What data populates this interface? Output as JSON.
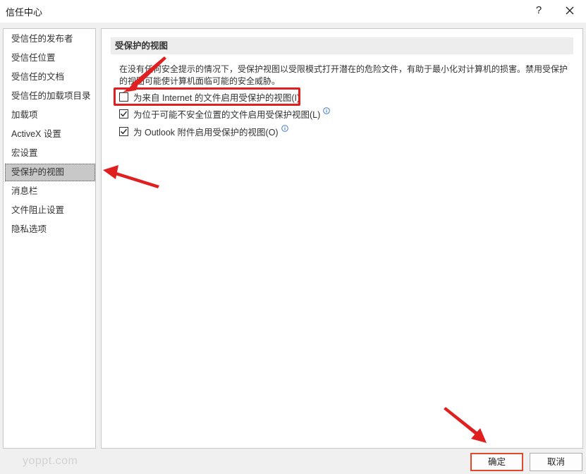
{
  "window": {
    "title": "信任中心",
    "help_label": "?"
  },
  "sidebar": {
    "items": [
      {
        "label": "受信任的发布者"
      },
      {
        "label": "受信任位置"
      },
      {
        "label": "受信任的文档"
      },
      {
        "label": "受信任的加载项目录"
      },
      {
        "label": "加载项"
      },
      {
        "label": "ActiveX 设置"
      },
      {
        "label": "宏设置"
      },
      {
        "label": "受保护的视图",
        "selected": true
      },
      {
        "label": "消息栏"
      },
      {
        "label": "文件阻止设置"
      },
      {
        "label": "隐私选项"
      }
    ]
  },
  "content": {
    "section_title": "受保护的视图",
    "description_line1": "在没有任何安全提示的情况下，受保护视图以受限模式打开潜在的危险文件，有助于最小化对计算机的损害。禁用受保护",
    "description_line2": "的视图可能使计算机面临可能的安全威胁。",
    "options": [
      {
        "label": "为来自 Internet 的文件启用受保护的视图(I)",
        "checked": false,
        "info": false
      },
      {
        "label": "为位于可能不安全位置的文件启用受保护视图(L)",
        "checked": true,
        "info": true
      },
      {
        "label": "为 Outlook 附件启用受保护的视图(O)",
        "checked": true,
        "info": true
      }
    ]
  },
  "buttons": {
    "ok_label": "确定",
    "cancel_label": "取消"
  },
  "watermark": "yoppt.com",
  "colors": {
    "annotation_red": "#e02020",
    "ok_border": "#e04a2a",
    "selected_bg": "#c8c8c8",
    "info_blue": "#2b6cc4"
  },
  "icons": {
    "close": "close-icon",
    "checkmark": "checkmark-icon",
    "info": "info-icon",
    "arrow": "red-arrow-annotation"
  }
}
